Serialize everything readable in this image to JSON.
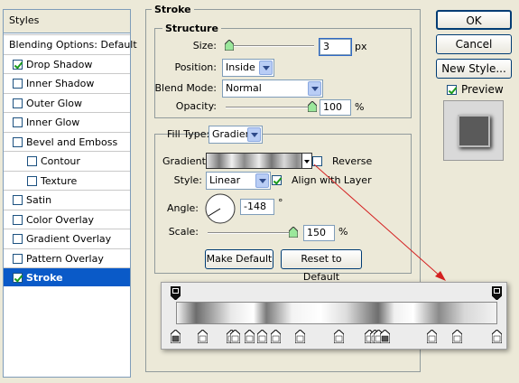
{
  "styles_panel": {
    "header": "Styles",
    "items": [
      {
        "label": "Blending Options: Default",
        "checkbox": false,
        "checked": false,
        "selected": false,
        "sub": false,
        "top": true
      },
      {
        "label": "Drop Shadow",
        "checkbox": true,
        "checked": true,
        "selected": false,
        "sub": false
      },
      {
        "label": "Inner Shadow",
        "checkbox": true,
        "checked": false,
        "selected": false,
        "sub": false
      },
      {
        "label": "Outer Glow",
        "checkbox": true,
        "checked": false,
        "selected": false,
        "sub": false
      },
      {
        "label": "Inner Glow",
        "checkbox": true,
        "checked": false,
        "selected": false,
        "sub": false
      },
      {
        "label": "Bevel and Emboss",
        "checkbox": true,
        "checked": false,
        "selected": false,
        "sub": false
      },
      {
        "label": "Contour",
        "checkbox": true,
        "checked": false,
        "selected": false,
        "sub": true
      },
      {
        "label": "Texture",
        "checkbox": true,
        "checked": false,
        "selected": false,
        "sub": true
      },
      {
        "label": "Satin",
        "checkbox": true,
        "checked": false,
        "selected": false,
        "sub": false
      },
      {
        "label": "Color Overlay",
        "checkbox": true,
        "checked": false,
        "selected": false,
        "sub": false
      },
      {
        "label": "Gradient Overlay",
        "checkbox": true,
        "checked": false,
        "selected": false,
        "sub": false
      },
      {
        "label": "Pattern Overlay",
        "checkbox": true,
        "checked": false,
        "selected": false,
        "sub": false
      },
      {
        "label": "Stroke",
        "checkbox": true,
        "checked": true,
        "selected": true,
        "sub": false
      }
    ]
  },
  "stroke": {
    "title": "Stroke",
    "structure_title": "Structure",
    "size_label": "Size:",
    "size_value": "3",
    "size_unit": "px",
    "position_label": "Position:",
    "position_value": "Inside",
    "blend_label": "Blend Mode:",
    "blend_value": "Normal",
    "opacity_label": "Opacity:",
    "opacity_value": "100",
    "opacity_unit": "%",
    "fill_type_label": "Fill Type:",
    "fill_type_value": "Gradient",
    "gradient_label": "Gradient:",
    "reverse_label": "Reverse",
    "reverse_checked": false,
    "style_label": "Style:",
    "style_value": "Linear",
    "align_label": "Align with Layer",
    "align_checked": true,
    "angle_label": "Angle:",
    "angle_value": "-148",
    "angle_unit": "°",
    "scale_label": "Scale:",
    "scale_value": "150",
    "scale_unit": "%",
    "make_default": "Make Default",
    "reset_default": "Reset to Default"
  },
  "side_buttons": {
    "ok": "OK",
    "cancel": "Cancel",
    "new_style": "New Style...",
    "preview_label": "Preview",
    "preview_checked": true
  },
  "colors": {
    "accent_selected": "#0a5ac8",
    "arrow": "#d42020",
    "check": "#1a9a1a"
  }
}
